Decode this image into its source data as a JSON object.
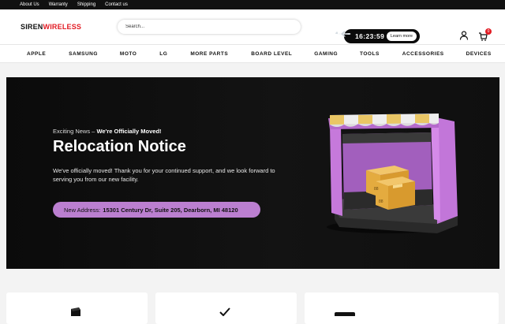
{
  "topbar": {
    "links": [
      "About Us",
      "Warranty",
      "Shipping",
      "Contact us"
    ]
  },
  "header": {
    "logo_part1": "SIREN",
    "logo_part2": "WIRELESS",
    "search_placeholder": "Search...",
    "promo_timer": "16:23:59",
    "promo_button": "Learn more",
    "cart_count": "0"
  },
  "nav": {
    "items": [
      "APPLE",
      "SAMSUNG",
      "MOTO",
      "LG",
      "MORE PARTS",
      "BOARD LEVEL",
      "GAMING",
      "TOOLS",
      "ACCESSORIES",
      "DEVICES"
    ]
  },
  "hero": {
    "eyebrow_prefix": "Exciting News – ",
    "eyebrow_bold": "We're Officially Moved!",
    "title": "Relocation Notice",
    "description": "We've officially moved! Thank you for your continued support, and we look forward to serving you from our new facility.",
    "address_label": "New Address:",
    "address_value": "15301 Century Dr, Suite 205, Dearborn, MI 48120"
  },
  "colors": {
    "brand_red": "#e21b23",
    "accent_purple": "#bb7fd0",
    "dark": "#0b0b0b"
  },
  "icons": [
    "user-icon",
    "cart-icon",
    "airplane-icon",
    "box-icon",
    "check-icon",
    "card-icon"
  ]
}
